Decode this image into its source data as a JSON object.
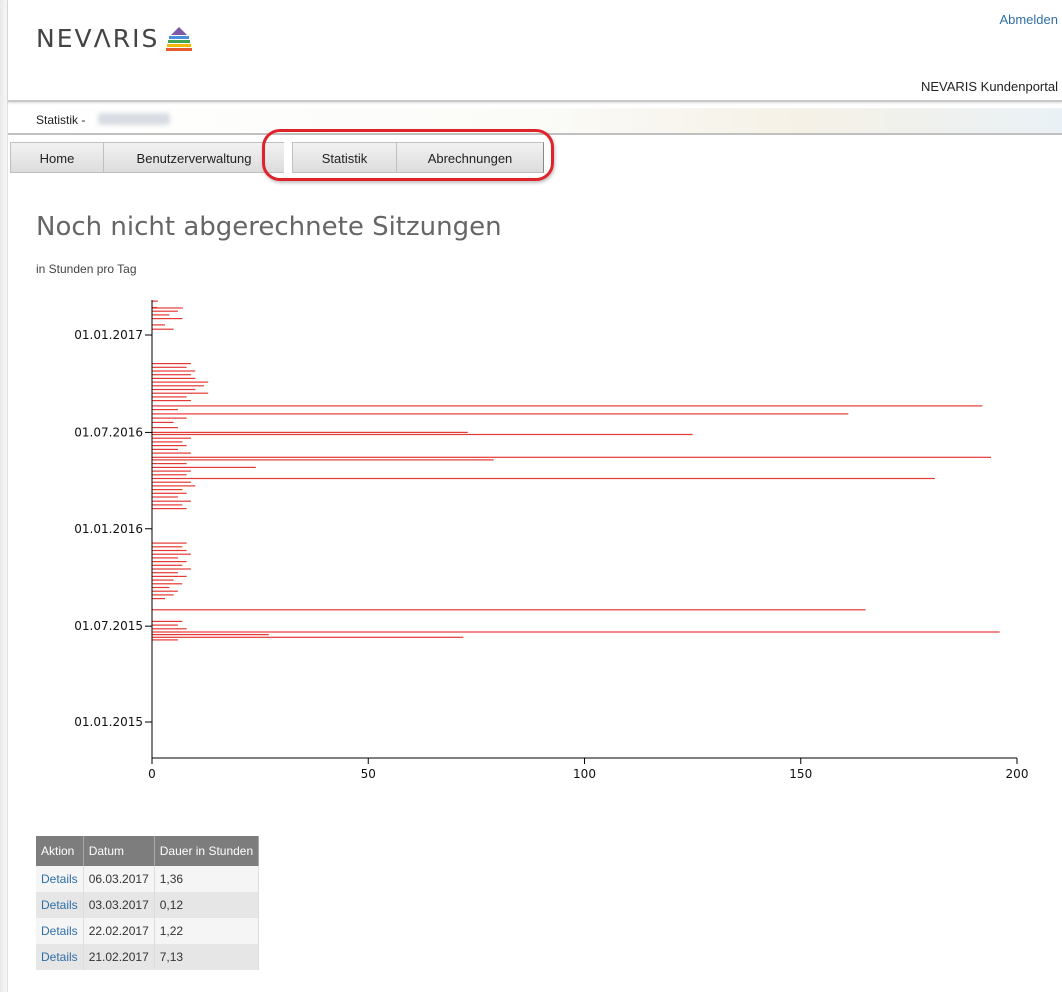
{
  "header": {
    "logo_text": "NEVΛRIS",
    "logout_label": "Abmelden",
    "portal_title": "NEVARIS Kundenportal"
  },
  "breadcrumb": {
    "label": "Statistik -"
  },
  "tabs": [
    {
      "label": "Home"
    },
    {
      "label": "Benutzerverwaltung"
    },
    {
      "label": "Statistik"
    },
    {
      "label": "Abrechnungen"
    }
  ],
  "page": {
    "title": "Noch nicht abgerechnete Sitzungen",
    "subtitle": "in Stunden pro Tag"
  },
  "chart_data": {
    "type": "bar",
    "orientation": "horizontal",
    "xlim": [
      0,
      200
    ],
    "x_ticks": [
      "0",
      "50",
      "100",
      "150",
      "200"
    ],
    "y_ticks": [
      "01.01.2017",
      "01.07.2016",
      "01.01.2016",
      "01.07.2015",
      "01.01.2015"
    ],
    "bar_color": "#e53935",
    "series": [
      {
        "date": "2017-03-06",
        "value": 1.36
      },
      {
        "date": "2017-03-03",
        "value": 0.12
      },
      {
        "date": "2017-02-22",
        "value": 1.22
      },
      {
        "date": "2017-02-21",
        "value": 7.13
      },
      {
        "date": "2017-02-15",
        "value": 6
      },
      {
        "date": "2017-02-08",
        "value": 4
      },
      {
        "date": "2017-02-01",
        "value": 7
      },
      {
        "date": "2017-01-20",
        "value": 3
      },
      {
        "date": "2017-01-12",
        "value": 5
      },
      {
        "date": "2016-11-08",
        "value": 9
      },
      {
        "date": "2016-11-01",
        "value": 8
      },
      {
        "date": "2016-10-25",
        "value": 10
      },
      {
        "date": "2016-10-18",
        "value": 9
      },
      {
        "date": "2016-10-11",
        "value": 10
      },
      {
        "date": "2016-10-04",
        "value": 13
      },
      {
        "date": "2016-09-27",
        "value": 12
      },
      {
        "date": "2016-09-20",
        "value": 10
      },
      {
        "date": "2016-09-13",
        "value": 13
      },
      {
        "date": "2016-09-06",
        "value": 8
      },
      {
        "date": "2016-08-30",
        "value": 9
      },
      {
        "date": "2016-08-20",
        "value": 192
      },
      {
        "date": "2016-08-13",
        "value": 6
      },
      {
        "date": "2016-08-05",
        "value": 161
      },
      {
        "date": "2016-07-28",
        "value": 8
      },
      {
        "date": "2016-07-20",
        "value": 5
      },
      {
        "date": "2016-07-10",
        "value": 6
      },
      {
        "date": "2016-07-01",
        "value": 73
      },
      {
        "date": "2016-06-27",
        "value": 125
      },
      {
        "date": "2016-06-20",
        "value": 9
      },
      {
        "date": "2016-06-13",
        "value": 7
      },
      {
        "date": "2016-06-06",
        "value": 8
      },
      {
        "date": "2016-05-30",
        "value": 6
      },
      {
        "date": "2016-05-23",
        "value": 9
      },
      {
        "date": "2016-05-15",
        "value": 194
      },
      {
        "date": "2016-05-10",
        "value": 79
      },
      {
        "date": "2016-05-03",
        "value": 8
      },
      {
        "date": "2016-04-26",
        "value": 24
      },
      {
        "date": "2016-04-19",
        "value": 9
      },
      {
        "date": "2016-04-12",
        "value": 8
      },
      {
        "date": "2016-04-05",
        "value": 181
      },
      {
        "date": "2016-03-29",
        "value": 9
      },
      {
        "date": "2016-03-22",
        "value": 10
      },
      {
        "date": "2016-03-15",
        "value": 7
      },
      {
        "date": "2016-03-08",
        "value": 8
      },
      {
        "date": "2016-03-01",
        "value": 6
      },
      {
        "date": "2016-02-22",
        "value": 9
      },
      {
        "date": "2016-02-15",
        "value": 7
      },
      {
        "date": "2016-02-08",
        "value": 8
      },
      {
        "date": "2015-12-05",
        "value": 8
      },
      {
        "date": "2015-11-28",
        "value": 7
      },
      {
        "date": "2015-11-21",
        "value": 8
      },
      {
        "date": "2015-11-14",
        "value": 9
      },
      {
        "date": "2015-11-07",
        "value": 6
      },
      {
        "date": "2015-10-31",
        "value": 8
      },
      {
        "date": "2015-10-24",
        "value": 7
      },
      {
        "date": "2015-10-17",
        "value": 9
      },
      {
        "date": "2015-10-10",
        "value": 6
      },
      {
        "date": "2015-10-03",
        "value": 8
      },
      {
        "date": "2015-09-26",
        "value": 5
      },
      {
        "date": "2015-09-19",
        "value": 7
      },
      {
        "date": "2015-09-12",
        "value": 4
      },
      {
        "date": "2015-09-05",
        "value": 6
      },
      {
        "date": "2015-08-29",
        "value": 5
      },
      {
        "date": "2015-08-22",
        "value": 3
      },
      {
        "date": "2015-08-01",
        "value": 165
      },
      {
        "date": "2015-07-10",
        "value": 7
      },
      {
        "date": "2015-07-03",
        "value": 6
      },
      {
        "date": "2015-06-26",
        "value": 8
      },
      {
        "date": "2015-06-20",
        "value": 196
      },
      {
        "date": "2015-06-15",
        "value": 27
      },
      {
        "date": "2015-06-10",
        "value": 72
      },
      {
        "date": "2015-06-05",
        "value": 6
      }
    ]
  },
  "table": {
    "headers": [
      "Aktion",
      "Datum",
      "Dauer in Stunden"
    ],
    "rows": [
      {
        "action": "Details",
        "date": "06.03.2017",
        "hours": "1,36"
      },
      {
        "action": "Details",
        "date": "03.03.2017",
        "hours": "0,12"
      },
      {
        "action": "Details",
        "date": "22.02.2017",
        "hours": "1,22"
      },
      {
        "action": "Details",
        "date": "21.02.2017",
        "hours": "7,13"
      }
    ]
  }
}
